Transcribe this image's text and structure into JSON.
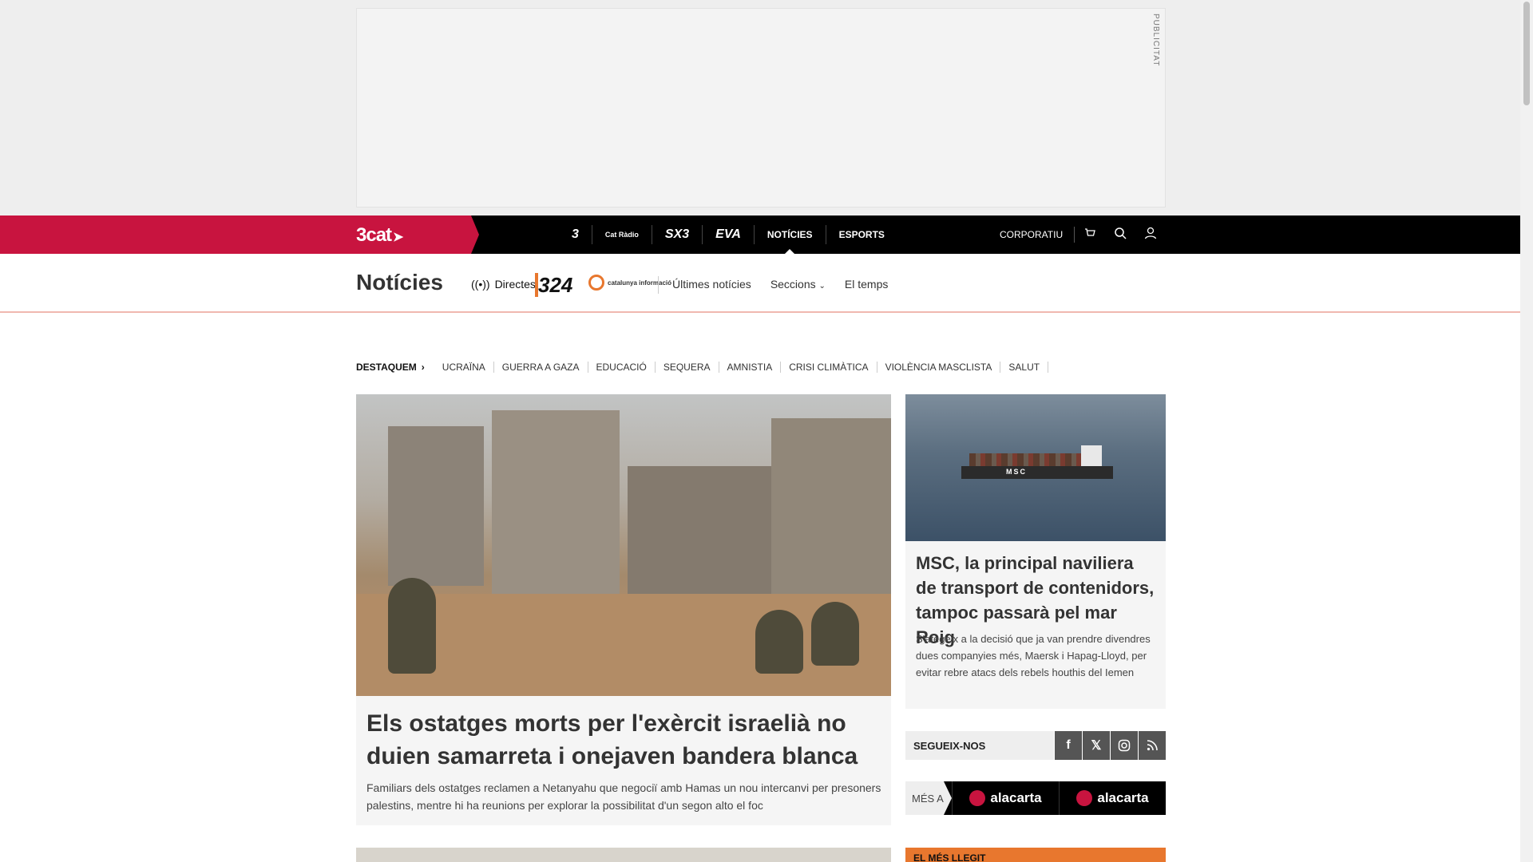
{
  "ad": {
    "label": "PUBLICITAT"
  },
  "topbar": {
    "brand": "3cat",
    "channels": [
      "3",
      "Cat Ràdio",
      "SX3",
      "EVA"
    ],
    "nav": [
      "NOTÍCIES",
      "ESPORTS"
    ],
    "corporatiu": "CORPORATIU",
    "icons": [
      "cart-icon",
      "search-icon",
      "user-icon"
    ]
  },
  "section": {
    "title": "Notícies",
    "directes": "Directes",
    "logo324": "324",
    "logo_ci": "catalunya informació",
    "links": [
      "Últimes notícies",
      "Seccions",
      "El temps"
    ]
  },
  "trending": {
    "lead": "DESTAQUEM",
    "tags": [
      "UCRAÏNA",
      "GUERRA A GAZA",
      "EDUCACIÓ",
      "SEQUERA",
      "AMNISTIA",
      "CRISI CLIMÀTICA",
      "VIOLÈNCIA MASCLISTA",
      "SALUT"
    ]
  },
  "main_article": {
    "title": "Els ostatges morts per l'exèrcit israelià no duien samarreta i onejaven bandera blanca",
    "subtitle": "Familiars dels ostatges reclamen a Netanyahu que negociï amb Hamas un nou intercanvi per presoners palestins, mentre hi ha reunions per explorar la possibilitat d'un segon alto el foc"
  },
  "side_article": {
    "title": "MSC, la principal naviliera de transport de contenidors, tampoc passarà pel mar Roig",
    "subtitle": "S'afegeix a la decisió que ja van prendre divendres dues companyies més, Maersk i Hapag-Lloyd, per evitar rebre atacs dels rebels houthis del Iemen",
    "image_text": "MSC"
  },
  "social": {
    "label": "SEGUEIX-NOS",
    "buttons": [
      "facebook-icon",
      "x-icon",
      "instagram-icon",
      "rss-icon"
    ]
  },
  "alacarta": {
    "mes": "MÉS A",
    "items": [
      "alacarta",
      "alacarta"
    ]
  },
  "bottom": {
    "most_read": "EL MÉS LLEGIT"
  },
  "colors": {
    "brand": "#c8143f",
    "accent324": "#e8772e",
    "topbar": "#000000"
  }
}
